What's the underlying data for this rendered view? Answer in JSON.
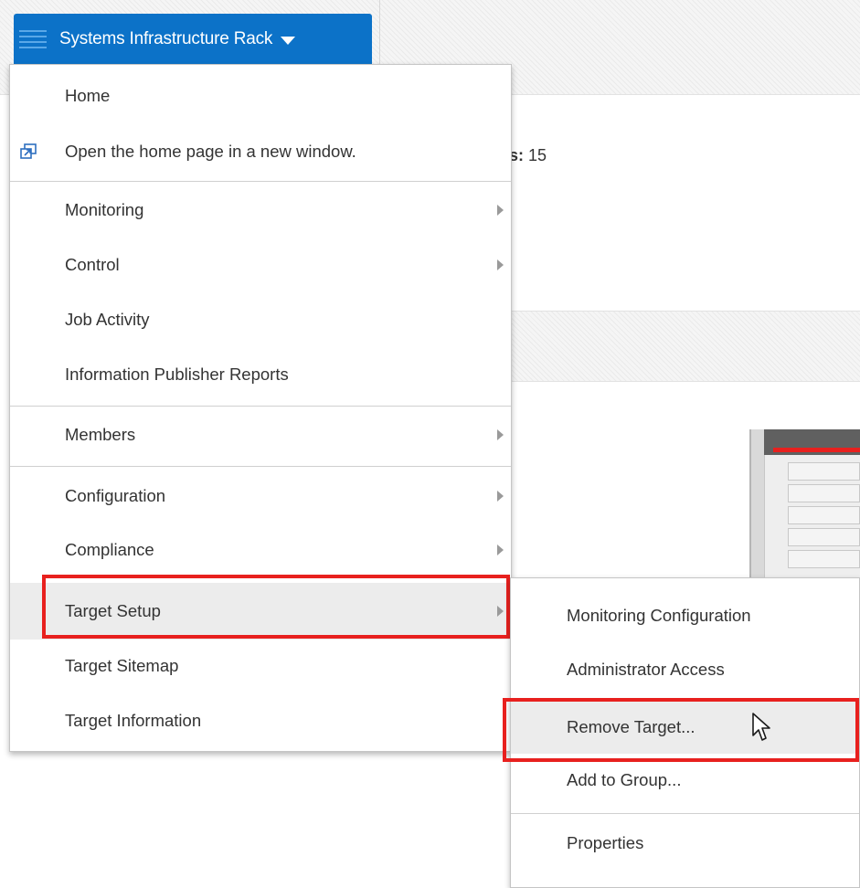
{
  "header": {
    "target_button_label": "Systems Infrastructure Rack",
    "menu_icon": "hamburger-icon",
    "caret_icon": "caret-down-icon"
  },
  "page": {
    "slots_label": "ots:",
    "slots_value": "15"
  },
  "menu": {
    "items": [
      {
        "label": "Home"
      },
      {
        "label": "Open the home page in a new window.",
        "icon": "new-window-icon"
      },
      {
        "label": "Monitoring",
        "submenu": true
      },
      {
        "label": "Control",
        "submenu": true
      },
      {
        "label": "Job Activity"
      },
      {
        "label": "Information Publisher Reports"
      },
      {
        "label": "Members",
        "submenu": true
      },
      {
        "label": "Configuration",
        "submenu": true
      },
      {
        "label": "Compliance",
        "submenu": true
      },
      {
        "label": "Target Setup",
        "submenu": true,
        "highlighted": true
      },
      {
        "label": "Target Sitemap"
      },
      {
        "label": "Target Information"
      }
    ]
  },
  "submenu": {
    "items": [
      {
        "label": "Monitoring Configuration"
      },
      {
        "label": "Administrator Access"
      },
      {
        "label": "Remove Target...",
        "highlighted": true
      },
      {
        "label": "Add to Group..."
      },
      {
        "label": "Properties"
      }
    ]
  },
  "colors": {
    "accent_button": "#0c72c8",
    "highlight_box": "#e8201e",
    "hover_background": "#ececec"
  }
}
